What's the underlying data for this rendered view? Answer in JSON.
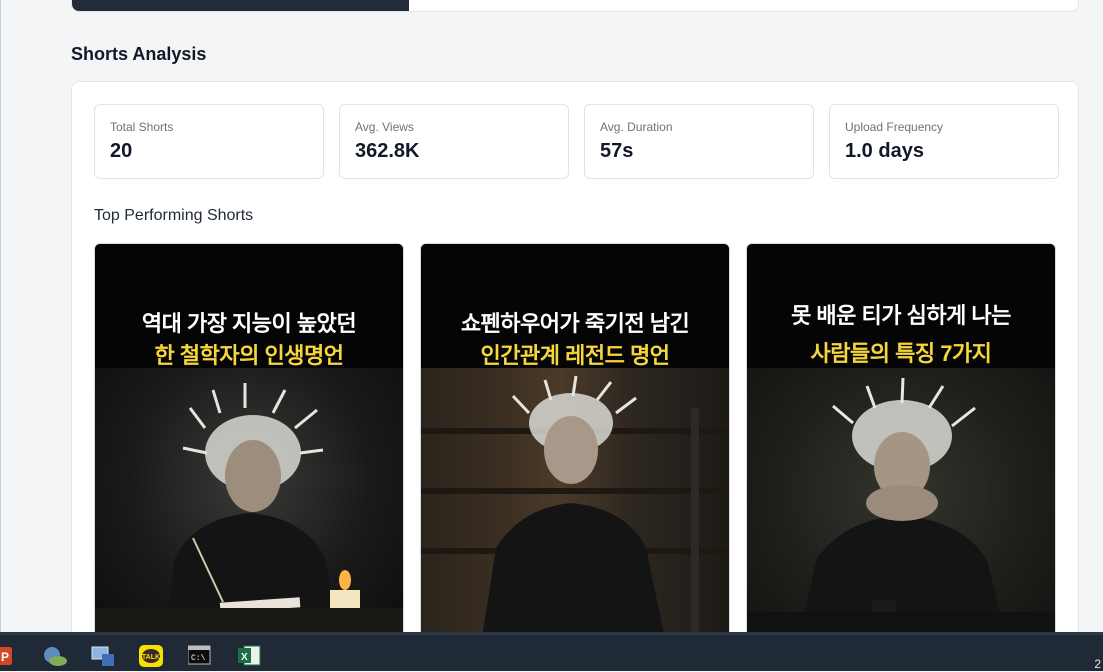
{
  "top_progress": {
    "fraction": 0.335,
    "fill_color": "#242b38"
  },
  "section_title": "Shorts Analysis",
  "stats": [
    {
      "label": "Total Shorts",
      "value": "20"
    },
    {
      "label": "Avg. Views",
      "value": "362.8K"
    },
    {
      "label": "Avg. Duration",
      "value": "57s"
    },
    {
      "label": "Upload Frequency",
      "value": "1.0 days"
    }
  ],
  "top_shorts_title": "Top Performing Shorts",
  "shorts": [
    {
      "line1": "역대 가장 지능이 높았던",
      "line2": "한 철학자의 인생명언"
    },
    {
      "line1": "쇼펜하우어가 죽기전 남긴",
      "line2": "인간관계 레전드 명언"
    },
    {
      "line1": "못 배운 티가 심하게 나는",
      "line2": "사람들의 특징 7가지"
    }
  ],
  "taskbar": {
    "icons": [
      "powerpoint-icon",
      "network-icon",
      "computer-icon",
      "kakaotalk-icon",
      "terminal-icon",
      "excel-icon"
    ],
    "kakao_label": "TALK",
    "clock_fragment": "2"
  }
}
